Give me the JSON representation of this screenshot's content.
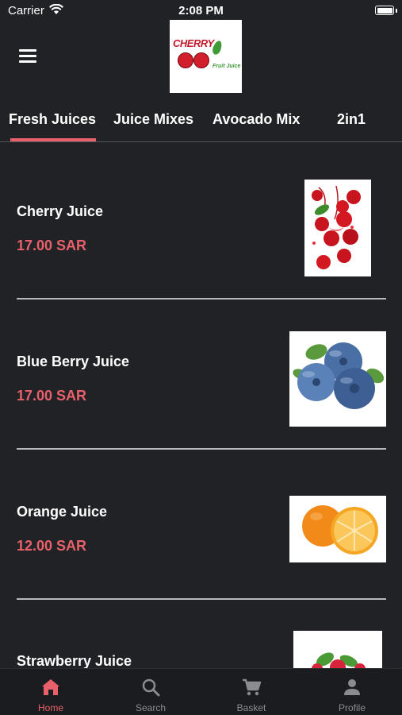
{
  "status_bar": {
    "carrier": "Carrier",
    "time": "2:08 PM"
  },
  "header": {
    "menu_icon": "hamburger-menu-icon",
    "logo": {
      "word": "CHERRY",
      "subtitle": "Fruit Juice"
    }
  },
  "tabs": [
    {
      "label": "Fresh Juices",
      "selected": true
    },
    {
      "label": "Juice Mixes",
      "selected": false
    },
    {
      "label": "Avocado Mix",
      "selected": false
    },
    {
      "label": "2in1",
      "selected": false
    }
  ],
  "products": [
    {
      "name": "Cherry Juice",
      "price": "17.00 SAR",
      "image": "cherries-image"
    },
    {
      "name": "Blue Berry Juice",
      "price": "17.00 SAR",
      "image": "blueberries-image"
    },
    {
      "name": "Orange Juice",
      "price": "12.00 SAR",
      "image": "oranges-image"
    },
    {
      "name": "Strawberry Juice",
      "image": "strawberries-image"
    }
  ],
  "bottom_nav": [
    {
      "label": "Home",
      "icon": "home-icon",
      "active": true
    },
    {
      "label": "Search",
      "icon": "search-icon",
      "active": false
    },
    {
      "label": "Basket",
      "icon": "cart-icon",
      "active": false
    },
    {
      "label": "Profile",
      "icon": "person-icon",
      "active": false
    }
  ],
  "colors": {
    "background": "#212225",
    "accent": "#e8606a",
    "bottom_bar": "#1b1c1f",
    "inactive_nav": "#8b8c90"
  }
}
